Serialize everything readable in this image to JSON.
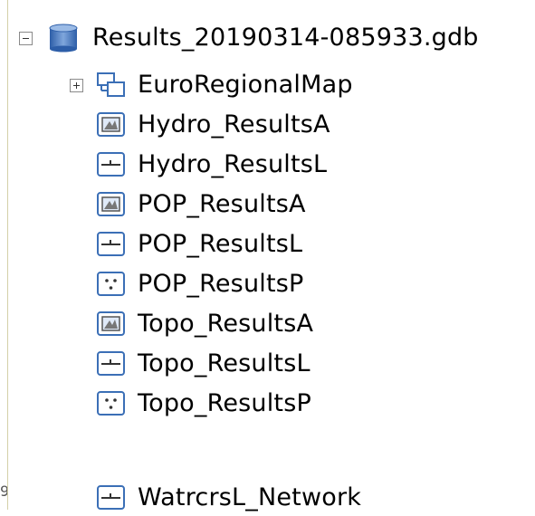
{
  "tree": {
    "root": {
      "label": "Results_20190314-085933.gdb",
      "expander": "collapse",
      "icon": "geodatabase-icon"
    },
    "children": [
      {
        "label": "EuroRegionalMap",
        "icon": "feature-dataset-icon",
        "expander": "expand"
      },
      {
        "label": "Hydro_ResultsA",
        "icon": "polygon-feature-class-icon"
      },
      {
        "label": "Hydro_ResultsL",
        "icon": "line-feature-class-icon"
      },
      {
        "label": "POP_ResultsA",
        "icon": "polygon-feature-class-icon"
      },
      {
        "label": "POP_ResultsL",
        "icon": "line-feature-class-icon"
      },
      {
        "label": "POP_ResultsP",
        "icon": "point-feature-class-icon"
      },
      {
        "label": "Topo_ResultsA",
        "icon": "polygon-feature-class-icon"
      },
      {
        "label": "Topo_ResultsL",
        "icon": "line-feature-class-icon"
      },
      {
        "label": "Topo_ResultsP",
        "icon": "point-feature-class-icon"
      },
      {
        "label": "WatrcrsL_Network",
        "icon": "line-feature-class-icon"
      }
    ]
  },
  "colors": {
    "icon_blue": "#3b6fb6",
    "icon_fill": "#dfe9f7",
    "db_blue": "#4d7fc4"
  }
}
